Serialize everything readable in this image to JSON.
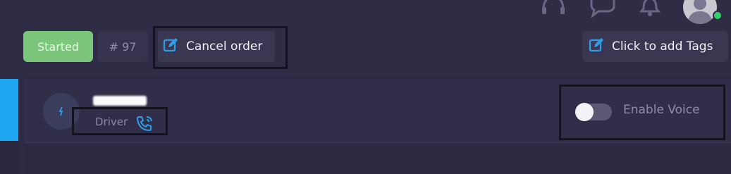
{
  "header": {
    "status": "Started",
    "order_id": "# 97",
    "cancel_label": "Cancel order",
    "tags_label": "Click to add Tags",
    "icons": [
      "headset-icon",
      "chat-icon",
      "bell-icon",
      "avatar"
    ]
  },
  "participant": {
    "role": "Driver",
    "name_redacted": true
  },
  "voice": {
    "label": "Enable Voice",
    "enabled": false
  },
  "colors": {
    "background": "#2d2a43",
    "status_green": "#7bc67a",
    "accent_blue": "#1ea7f0",
    "online_green": "#33d06b"
  }
}
